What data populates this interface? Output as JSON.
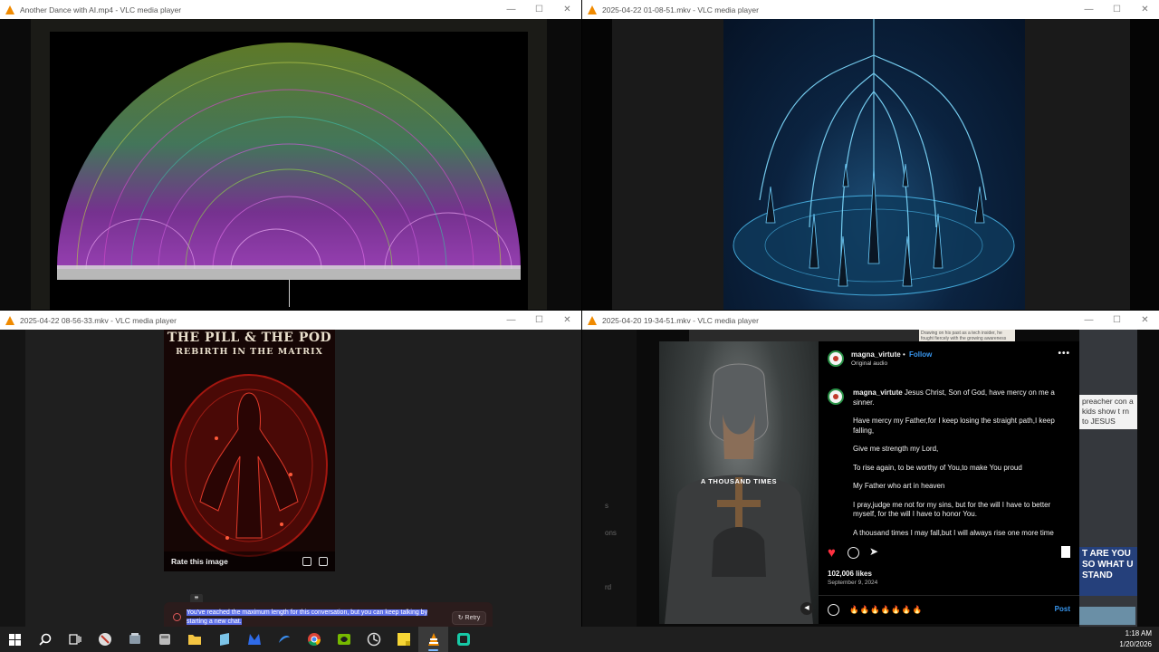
{
  "windows": [
    {
      "title": "Another Dance with AI.mp4 - VLC media player"
    },
    {
      "title": "2025-04-22 01-08-51.mkv - VLC media player"
    },
    {
      "title": "2025-04-22 08-56-33.mkv - VLC media player"
    },
    {
      "title": "2025-04-20 19-34-51.mkv - VLC media player"
    }
  ],
  "window_controls": {
    "minimize": "—",
    "maximize": "☐",
    "close": "✕"
  },
  "poster": {
    "title": "THE PILL & THE POD",
    "subtitle": "REBIRTH IN THE MATRIX"
  },
  "chat": {
    "rate_label": "Rate this image",
    "quote_glyph": "❞",
    "error_message": "You've reached the maximum length for this conversation, but you can keep talking by starting a new chat.",
    "retry_label": "↻ Retry"
  },
  "instagram": {
    "username": "magna_virtute",
    "follow_label": "Follow",
    "dot": "•",
    "audio_label": "Original audio",
    "more_glyph": "•••",
    "image_caption": "A THOUSAND TIMES",
    "caption_first": "Jesus Christ, Son of God, have mercy on me a sinner.",
    "caption_lines": [
      "Have mercy my Father,for I keep losing the straight path,I keep falling,",
      "Give me strength my Lord,",
      "To rise again, to be worthy of You,to make You proud",
      "My Father who art in heaven",
      "I pray,judge me not for my sins, but for the will I have to better myself, for the will I have to honor You.",
      "A thousand times I may fall,but I will always rise one more time"
    ],
    "likes": "102,006 likes",
    "date": "September 9, 2024",
    "comment_draft": "🔥🔥🔥🔥🔥🔥🔥",
    "post_label": "Post"
  },
  "background_snippets": {
    "left_fragments": [
      "s",
      "ons",
      "rd"
    ],
    "paper_text": "Drawing on his past as a tech insider, he fought fiercely with the growing awareness before…",
    "right_top": "preacher con a kids show t rn to JESUS",
    "right_banner": "T ARE YOU SO WHAT U STAND"
  },
  "taskbar": {
    "icons": [
      "windows-start-icon",
      "search-icon",
      "task-view-icon",
      "app-icon-1",
      "app-icon-2",
      "app-icon-3",
      "file-explorer-icon",
      "app-icon-4",
      "malwarebytes-icon",
      "app-icon-5",
      "chrome-icon",
      "nvidia-icon",
      "app-icon-6",
      "sticky-notes-icon",
      "vlc-icon",
      "app-icon-7"
    ],
    "time": "1:18 AM",
    "date": "1/20/2026"
  }
}
